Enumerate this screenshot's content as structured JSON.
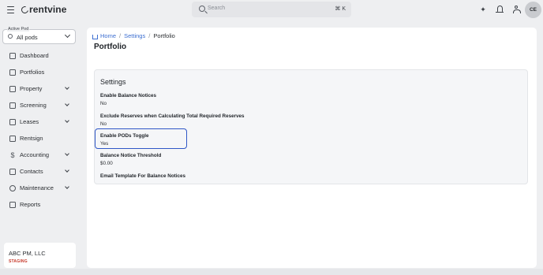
{
  "app": {
    "brand": "rentvine"
  },
  "search": {
    "placeholder": "Search",
    "shortcut": "⌘ K"
  },
  "user": {
    "initials": "CE"
  },
  "sidebar": {
    "pod_label": "Active Pod",
    "pod_value": "All pods",
    "items": [
      {
        "label": "Dashboard",
        "icon": "dashboard-icon",
        "expandable": false
      },
      {
        "label": "Portfolios",
        "icon": "folder-icon",
        "expandable": false
      },
      {
        "label": "Property",
        "icon": "building-icon",
        "expandable": true
      },
      {
        "label": "Screening",
        "icon": "screening-icon",
        "expandable": true
      },
      {
        "label": "Leases",
        "icon": "calendar-icon",
        "expandable": true
      },
      {
        "label": "Rentsign",
        "icon": "signature-icon",
        "expandable": false
      },
      {
        "label": "Accounting",
        "icon": "dollar-icon",
        "expandable": true
      },
      {
        "label": "Contacts",
        "icon": "contacts-icon",
        "expandable": true
      },
      {
        "label": "Maintenance",
        "icon": "wrench-icon",
        "expandable": true
      },
      {
        "label": "Reports",
        "icon": "chart-icon",
        "expandable": false
      }
    ],
    "org": {
      "name": "ABC PM, LLC",
      "env": "STAGING"
    }
  },
  "breadcrumb": {
    "home": "Home",
    "settings": "Settings",
    "current": "Portfolio"
  },
  "page": {
    "title": "Portfolio"
  },
  "settings": {
    "title": "Settings",
    "fields": [
      {
        "label": "Enable Balance Notices",
        "value": "No"
      },
      {
        "label": "Exclude Reserves when Calculating Total Required Reserves",
        "value": "No"
      },
      {
        "label": "Enable PODs Toggle",
        "value": "Yes"
      },
      {
        "label": "Balance Notice Threshold",
        "value": "$0.00"
      },
      {
        "label": "Email Template For Balance Notices",
        "value": ""
      }
    ]
  },
  "colors": {
    "accent": "#3d6fd1",
    "highlight_border": "#2f57c7",
    "staging": "#c7392b"
  }
}
